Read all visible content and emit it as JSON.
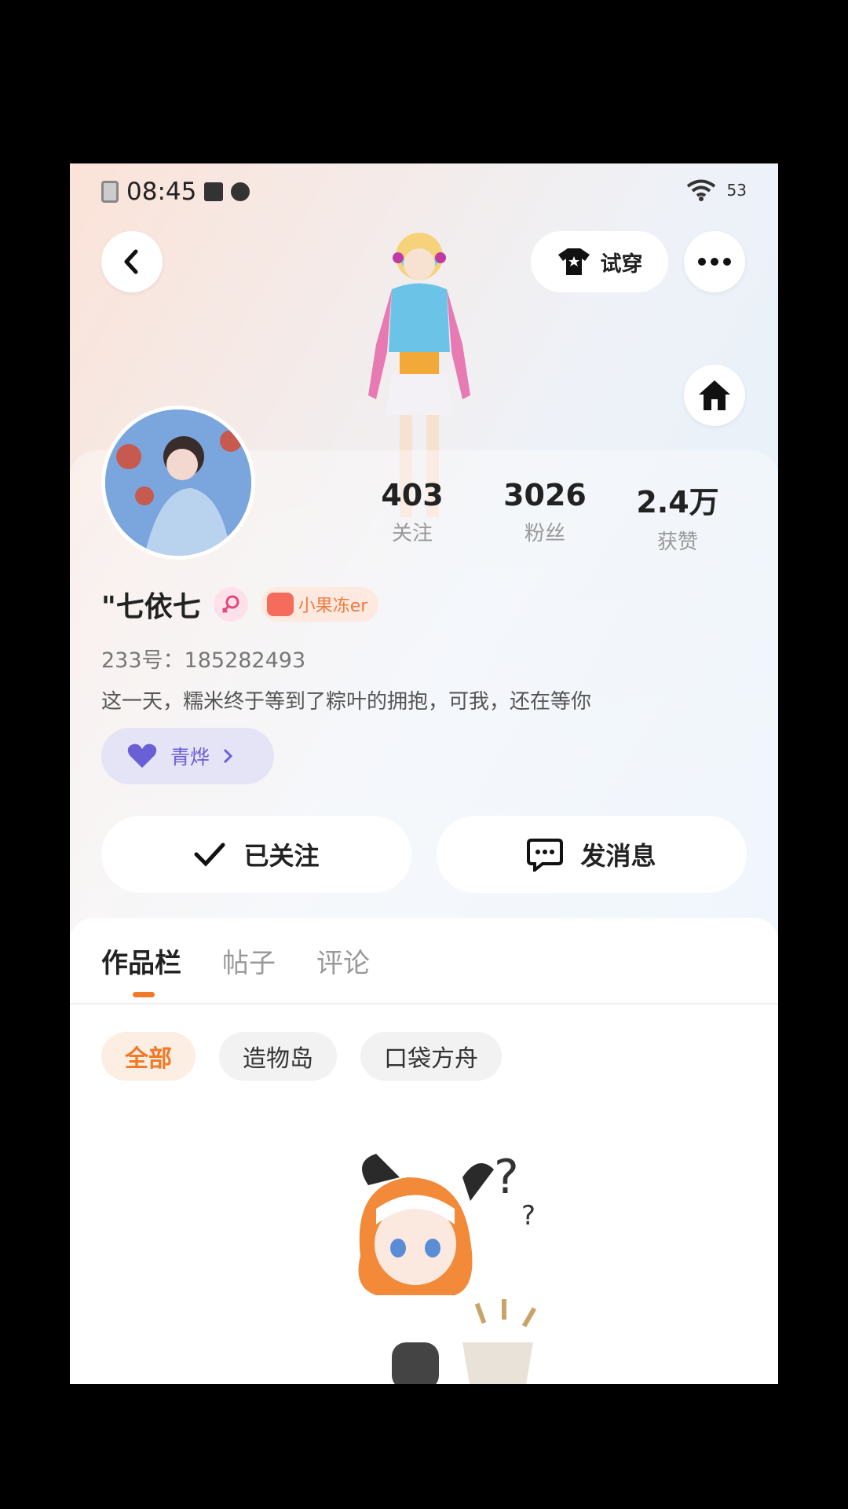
{
  "status_bar": {
    "time": "08:45",
    "battery": "53"
  },
  "header": {
    "try_on_label": "试穿"
  },
  "stats": [
    {
      "value": "403",
      "label": "关注"
    },
    {
      "value": "3026",
      "label": "粉丝"
    },
    {
      "value": "2.4万",
      "label": "获赞"
    }
  ],
  "profile": {
    "name": "\"七依七",
    "tag": "小果冻er",
    "uid": "233号：185282493",
    "bio": "这一天，糯米终于等到了粽叶的拥抱，可我，还在等你",
    "badge": "青烨"
  },
  "actions": {
    "following_label": "已关注",
    "message_label": "发消息"
  },
  "tabs": [
    "作品栏",
    "帖子",
    "评论"
  ],
  "filters": [
    "全部",
    "造物岛",
    "口袋方舟"
  ],
  "colors": {
    "accent": "#f07a28",
    "badge_purple": "#6b5fd6"
  }
}
